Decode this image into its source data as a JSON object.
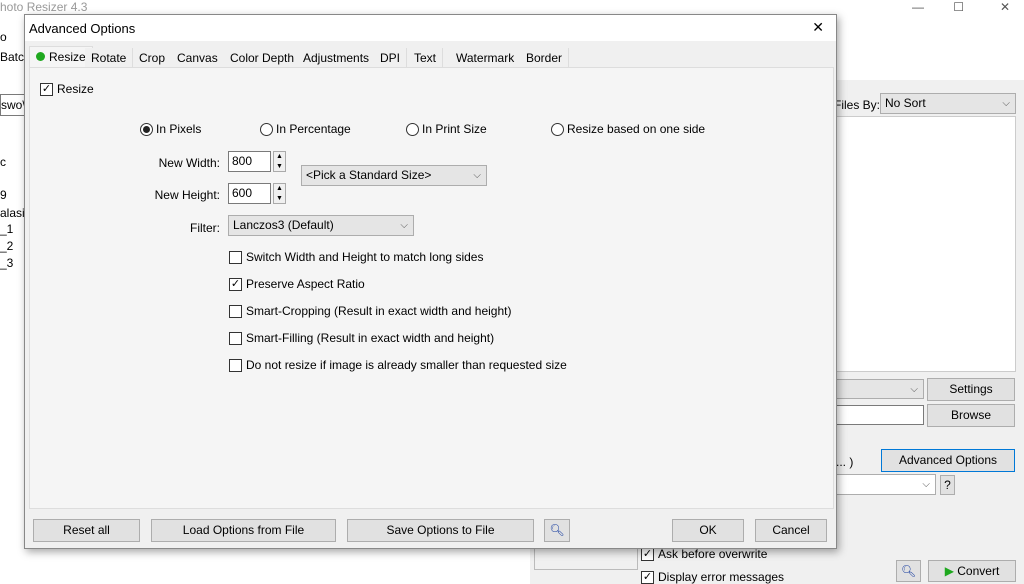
{
  "main_window": {
    "title": "hoto Resizer 4.3",
    "menu_fragment": "o",
    "tab_fragment": "Batch",
    "path_fragment": "swo\\i",
    "list_fragments": [
      "c",
      "9",
      "alasi A",
      "_1",
      "_2",
      "_3"
    ],
    "sort_label": "Files By:",
    "sort_value": "No Sort",
    "settings": "Settings",
    "browse": "Browse",
    "ellipsis": "... )",
    "advanced": "Advanced Options",
    "help": "?",
    "ask_overwrite": "Ask before overwrite",
    "display_errors": "Display error messages",
    "convert": "Convert"
  },
  "dialog": {
    "title": "Advanced Options",
    "close": "✕",
    "tabs": [
      "Resize",
      "Rotate",
      "Crop",
      "Canvas",
      "Color Depth",
      "Adjustments",
      "DPI",
      "Text",
      "Watermark",
      "Border"
    ],
    "resize_check": "Resize",
    "modes": [
      "In Pixels",
      "In Percentage",
      "In Print Size",
      "Resize based on one side"
    ],
    "selected_mode": "In Pixels",
    "width_label": "New Width:",
    "width": "800",
    "height_label": "New Height:",
    "height": "600",
    "standard_size": "<Pick a Standard Size>",
    "filter_label": "Filter:",
    "filter": "Lanczos3 (Default)",
    "options": [
      {
        "label": "Switch Width and Height to match long sides",
        "checked": false
      },
      {
        "label": "Preserve Aspect Ratio",
        "checked": true
      },
      {
        "label": "Smart-Cropping (Result in exact width and height)",
        "checked": false
      },
      {
        "label": "Smart-Filling (Result in exact width and height)",
        "checked": false
      },
      {
        "label": "Do not resize if image is already smaller than requested size",
        "checked": false
      }
    ],
    "reset": "Reset all",
    "load": "Load Options from File",
    "save": "Save Options to File",
    "ok": "OK",
    "cancel": "Cancel"
  },
  "colors": {
    "accent": "#0078d7",
    "status_green": "#1fa81f"
  }
}
